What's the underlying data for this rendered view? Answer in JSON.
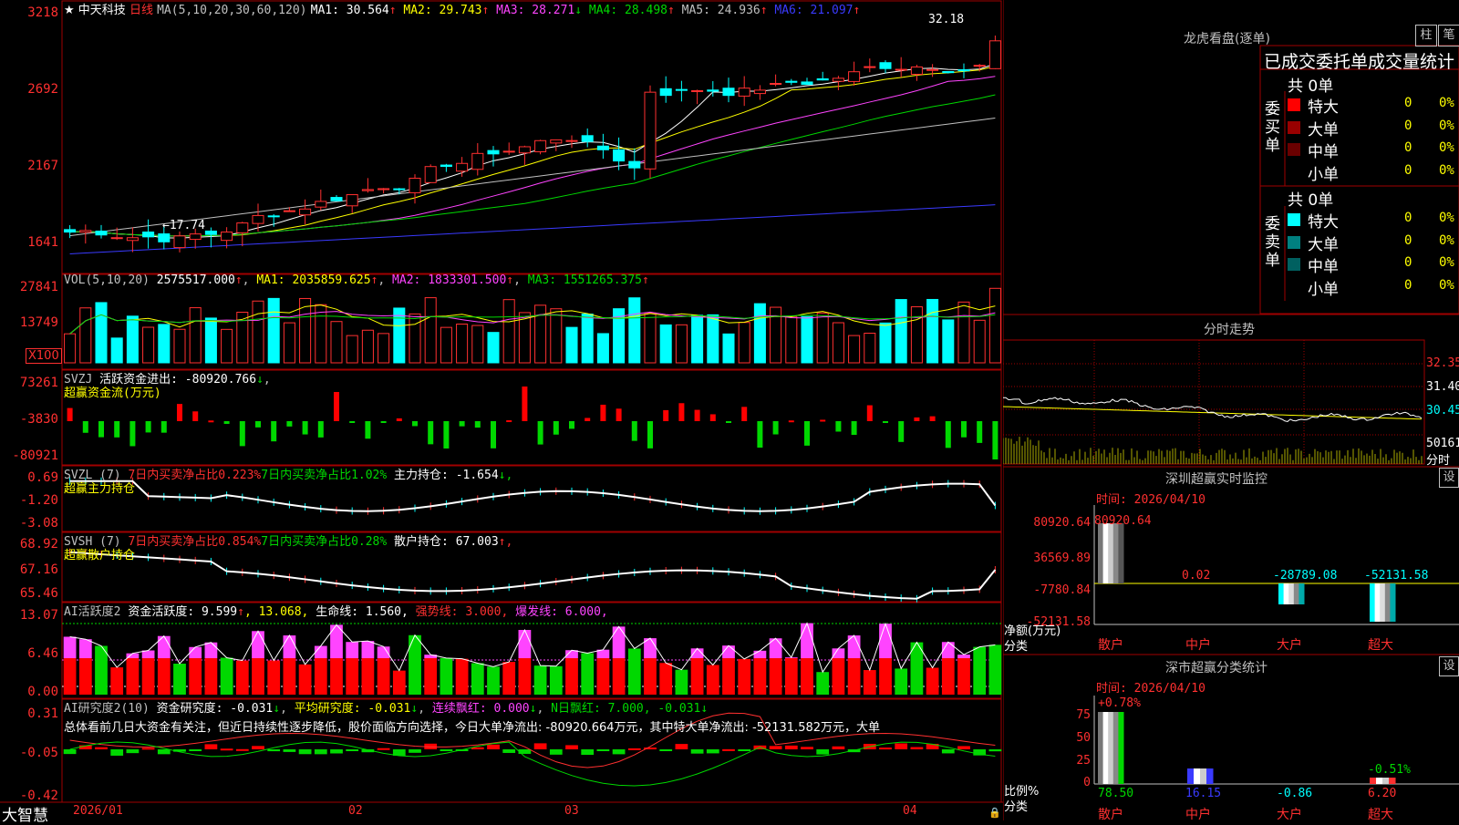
{
  "main": {
    "title_prefix": "★",
    "stock_name": "中天科技",
    "period": "日线",
    "ma_label": "MA(5,10,20,30,60,120)",
    "ma": [
      {
        "label": "MA1:",
        "value": "30.564",
        "arrow": "↑",
        "color": "#ffffff"
      },
      {
        "label": "MA2:",
        "value": "29.743",
        "arrow": "↑",
        "color": "#ffff00"
      },
      {
        "label": "MA3:",
        "value": "28.271",
        "arrow": "↓",
        "color": "#ff44ff"
      },
      {
        "label": "MA4:",
        "value": "28.498",
        "arrow": "↑",
        "color": "#00d800"
      },
      {
        "label": "MA5:",
        "value": "24.936",
        "arrow": "↑",
        "color": "#c0c0c0"
      },
      {
        "label": "MA6:",
        "value": "21.097",
        "arrow": "↑",
        "color": "#3a3aff"
      }
    ],
    "y_labels": [
      "3218",
      "2692",
      "2167",
      "1641"
    ],
    "high_note": "32.18",
    "low_note": "←17.74"
  },
  "vol": {
    "label": "VOL(5,10,20)",
    "value": "2575517.000",
    "ma1": "2035859.625",
    "ma2": "1833301.500",
    "ma3": "1551265.375",
    "y_labels": [
      "27841",
      "13749"
    ],
    "unit": "X100"
  },
  "svzj": {
    "label": "SVZJ",
    "desc": "活跃资金进出:",
    "value": "-80920.766",
    "arrow": "↓",
    "sub": "超赢资金流(万元)",
    "y_labels": [
      "73261",
      "-3830",
      "-80921"
    ]
  },
  "svzl": {
    "label": "SVZL (7)",
    "t1": "7日内买卖净占比0.223%",
    "t2": "7日内买卖净占比1.02%",
    "t3": "主力持仓:",
    "value": "-1.654",
    "arrow": "↓,",
    "sub": "超赢主力持仓",
    "y_labels": [
      "0.69",
      "-1.20",
      "-3.08"
    ]
  },
  "svsh": {
    "label": "SVSH (7)",
    "t1": "7日内买卖净占比0.854%",
    "t2": "7日内买卖净占比0.28%",
    "t3": "散户持仓:",
    "value": "67.003",
    "arrow": "↑,",
    "sub": "超赢散户持仓",
    "y_labels": [
      "68.92",
      "67.16",
      "65.46"
    ]
  },
  "ai1": {
    "label": "AI活跃度2",
    "t1": "资金活跃度: 9.599",
    "t2": ", 13.068,",
    "t3": "生命线: 1.560,",
    "t4": "强势线: 3.000,",
    "t5": "爆发线: 6.000,",
    "y_labels": [
      "13.07",
      "6.46",
      "0.00"
    ]
  },
  "ai2": {
    "label": "AI研究度2(10)",
    "t1": "资金研究度: -0.031",
    "t2": "平均研究度: -0.031",
    "t3": "连续飘红: 0.000",
    "t4": "N日飘红: 7.000, -0.031",
    "comment": "总体看前几日大资金有关注，但近日持续性逐步降低，股价面临方向选择，今日大单净流出: -80920.664万元，其中特大单净流出: -52131.582万元，大单",
    "y_labels": [
      "0.31",
      "-0.05",
      "-0.42"
    ]
  },
  "xaxis": {
    "labels": [
      "2026/01",
      "02",
      "03",
      "04"
    ]
  },
  "brand": "大智慧",
  "dragon": {
    "title": "龙虎看盘(逐单)",
    "btn1": "柱",
    "btn2": "笔",
    "header": "已成交委托单成交量统计",
    "buy": {
      "side_label": "委买单",
      "total": "共 0单",
      "rows": [
        {
          "name": "特大",
          "count": "0",
          "pct": "0%",
          "color": "#ff0000"
        },
        {
          "name": "大单",
          "count": "0",
          "pct": "0%",
          "color": "#990000"
        },
        {
          "name": "中单",
          "count": "0",
          "pct": "0%",
          "color": "#6a0000"
        },
        {
          "name": "小单",
          "count": "0",
          "pct": "0%",
          "color": "#000000"
        }
      ]
    },
    "sell": {
      "side_label": "委卖单",
      "total": "共 0单",
      "rows": [
        {
          "name": "特大",
          "count": "0",
          "pct": "0%",
          "color": "#00ffff"
        },
        {
          "name": "大单",
          "count": "0",
          "pct": "0%",
          "color": "#008080"
        },
        {
          "name": "中单",
          "count": "0",
          "pct": "0%",
          "color": "#006060"
        },
        {
          "name": "小单",
          "count": "0",
          "pct": "0%",
          "color": "#000000"
        }
      ]
    }
  },
  "intraday": {
    "title": "分时走势",
    "y_labels": [
      "32.35",
      "31.40",
      "30.45"
    ],
    "vol_label": "50161",
    "vol_unit": "分时"
  },
  "monitor": {
    "title": "深圳超赢实时监控",
    "setting": "设",
    "time": "时间: 2026/04/10",
    "y_labels": [
      "80920.64",
      "36569.89",
      "-7780.84",
      "-52131.58"
    ],
    "axis_title": "净额(万元)",
    "axis_sub": "分类",
    "bars": [
      {
        "label": "散户",
        "value": "80920.64"
      },
      {
        "label": "中户",
        "value": "0.02"
      },
      {
        "label": "大户",
        "value": "-28789.08"
      },
      {
        "label": "超大",
        "value": "-52131.58"
      }
    ]
  },
  "stats": {
    "title": "深市超赢分类统计",
    "setting": "设",
    "time": "时间: 2026/04/10",
    "y_labels": [
      "75",
      "50",
      "25",
      "0"
    ],
    "axis_title": "比例%",
    "axis_sub": "分类",
    "bars": [
      {
        "label": "散户",
        "value": "78.50",
        "change": "+0.78%"
      },
      {
        "label": "中户",
        "value": "16.15",
        "change": ""
      },
      {
        "label": "大户",
        "value": "-0.86",
        "change": ""
      },
      {
        "label": "超大",
        "value": "6.20",
        "change": "-0.51%"
      }
    ]
  }
}
